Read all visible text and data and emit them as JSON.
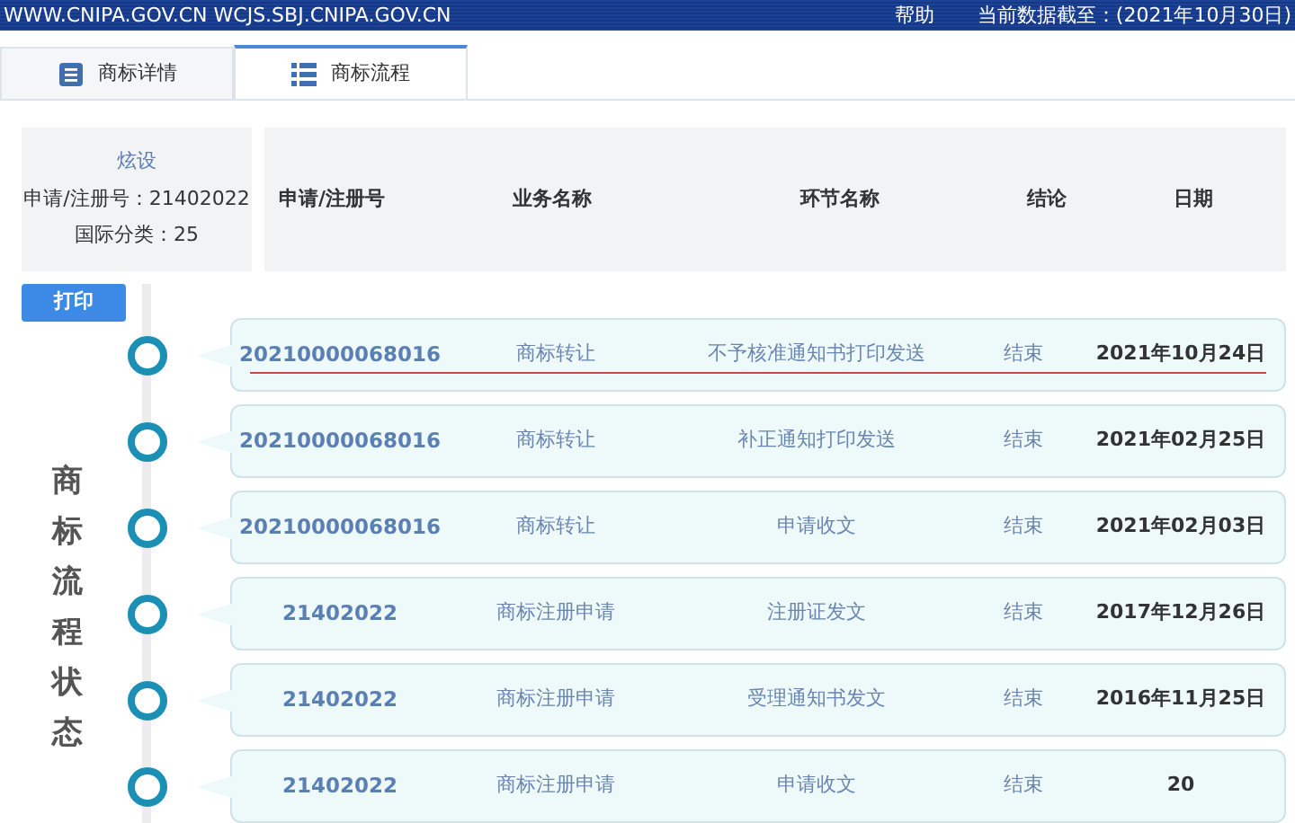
{
  "top_bar": {
    "sites": "WWW.CNIPA.GOV.CN WCJS.SBJ.CNIPA.GOV.CN",
    "help": "帮助",
    "data_date": "当前数据截至：(2021年10月30日)"
  },
  "tabs": [
    {
      "label": "商标详情",
      "kind": "details",
      "selected": false
    },
    {
      "label": "商标流程",
      "kind": "process",
      "selected": true
    }
  ],
  "mark_info": {
    "name": "炫设",
    "reg_no": "申请/注册号：21402022",
    "class": "国际分类：25"
  },
  "print_button": "打印",
  "side_title": "商标流程状态",
  "table": {
    "columns": [
      "申请/注册号",
      "业务名称",
      "环节名称",
      "结论",
      "日期"
    ],
    "rows": [
      {
        "number": "20210000068016",
        "business": "商标转让",
        "step": "不予核准通知书打印发送",
        "result": "结束",
        "date": "2021年10月24日",
        "highlighted": true
      },
      {
        "number": "20210000068016",
        "business": "商标转让",
        "step": "补正通知打印发送",
        "result": "结束",
        "date": "2021年02月25日",
        "highlighted": false
      },
      {
        "number": "20210000068016",
        "business": "商标转让",
        "step": "申请收文",
        "result": "结束",
        "date": "2021年02月03日",
        "highlighted": false
      },
      {
        "number": "21402022",
        "business": "商标注册申请",
        "step": "注册证发文",
        "result": "结束",
        "date": "2017年12月26日",
        "highlighted": false
      },
      {
        "number": "21402022",
        "business": "商标注册申请",
        "step": "受理通知书发文",
        "result": "结束",
        "date": "2016年11月25日",
        "highlighted": false
      },
      {
        "number": "21402022",
        "business": "商标注册申请",
        "step": "申请收文",
        "result": "结束",
        "date": "20",
        "highlighted": false
      }
    ]
  }
}
